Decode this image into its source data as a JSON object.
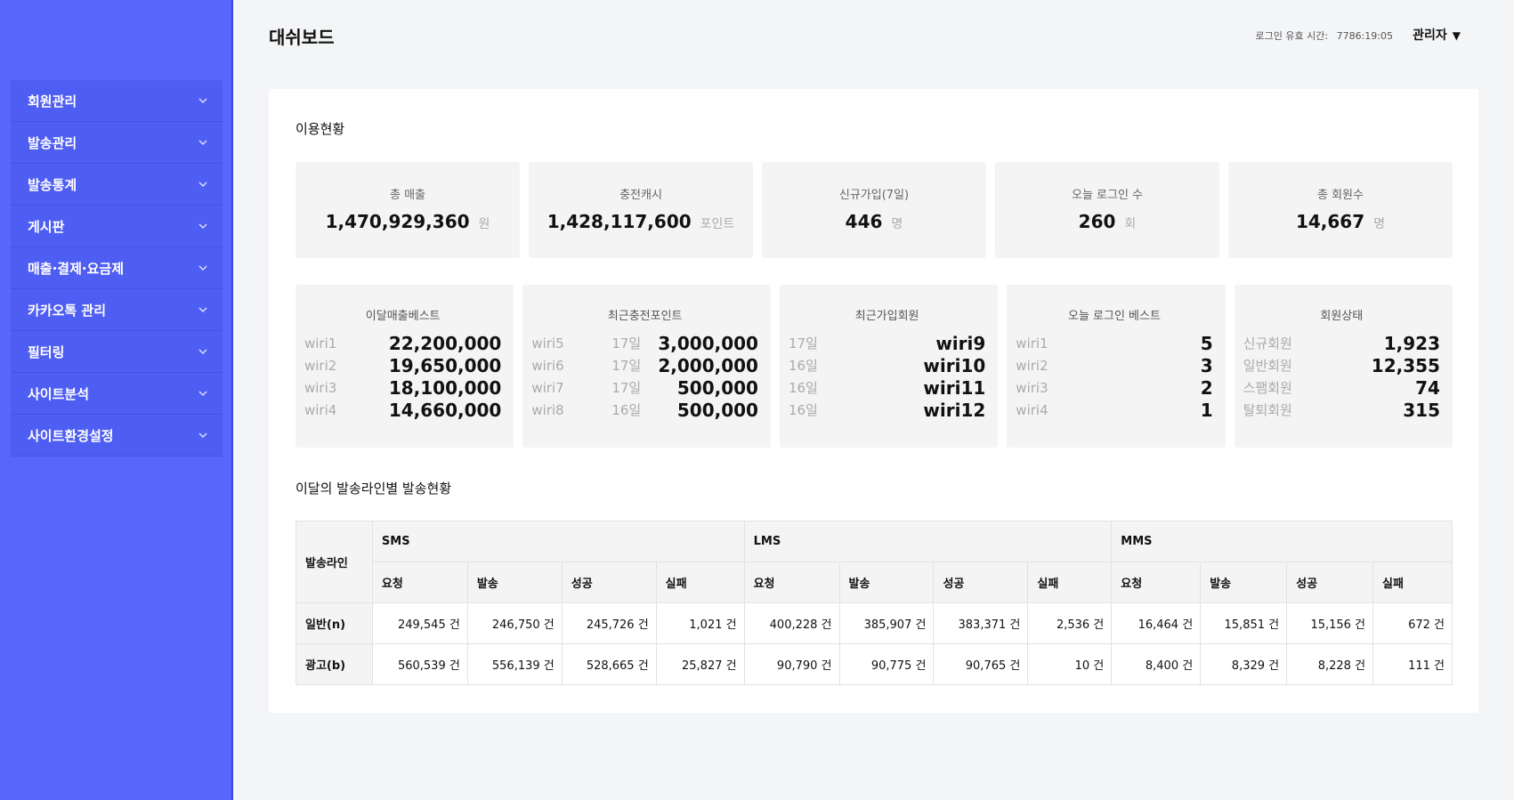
{
  "sidebar": {
    "items": [
      {
        "label": "회원관리",
        "icon": "chevron-down-icon"
      },
      {
        "label": "발송관리",
        "icon": "chevron-down-icon"
      },
      {
        "label": "발송통계",
        "icon": "chevron-down-icon"
      },
      {
        "label": "게시판",
        "icon": "chevron-down-icon"
      },
      {
        "label": "매출·결제·요금제",
        "icon": "chevron-down-icon"
      },
      {
        "label": "카카오톡 관리",
        "icon": "chevron-down-icon"
      },
      {
        "label": "필터링",
        "icon": "chevron-down-icon"
      },
      {
        "label": "사이트분석",
        "icon": "chevron-down-icon"
      },
      {
        "label": "사이트환경설정",
        "icon": "chevron-down-icon"
      }
    ]
  },
  "header": {
    "title": "대쉬보드",
    "login_label": "로그인 유효 시간:",
    "login_time": "7786:19:05",
    "admin_label": "관리자",
    "admin_icon": "caret-down-icon"
  },
  "usage": {
    "title": "이용현황",
    "stats": [
      {
        "label": "총 매출",
        "value": "1,470,929,360",
        "unit": "원"
      },
      {
        "label": "충전캐시",
        "value": "1,428,117,600",
        "unit": "포인트"
      },
      {
        "label": "신규가입(7일)",
        "value": "446",
        "unit": "명"
      },
      {
        "label": "오늘 로그인 수",
        "value": "260",
        "unit": "회"
      },
      {
        "label": "총 회원수",
        "value": "14,667",
        "unit": "명"
      }
    ],
    "best": [
      {
        "title": "이달매출베스트",
        "items": [
          {
            "key": "wiri1",
            "date": "",
            "value": "22,200,000"
          },
          {
            "key": "wiri2",
            "date": "",
            "value": "19,650,000"
          },
          {
            "key": "wiri3",
            "date": "",
            "value": "18,100,000"
          },
          {
            "key": "wiri4",
            "date": "",
            "value": "14,660,000"
          }
        ]
      },
      {
        "title": "최근충전포인트",
        "items": [
          {
            "key": "wiri5",
            "date": "17일",
            "value": "3,000,000"
          },
          {
            "key": "wiri6",
            "date": "17일",
            "value": "2,000,000"
          },
          {
            "key": "wiri7",
            "date": "17일",
            "value": "500,000"
          },
          {
            "key": "wiri8",
            "date": "16일",
            "value": "500,000"
          }
        ]
      },
      {
        "title": "최근가입회원",
        "items": [
          {
            "key": "17일",
            "date": "",
            "value": "wiri9"
          },
          {
            "key": "16일",
            "date": "",
            "value": "wiri10"
          },
          {
            "key": "16일",
            "date": "",
            "value": "wiri11"
          },
          {
            "key": "16일",
            "date": "",
            "value": "wiri12"
          }
        ]
      },
      {
        "title": "오늘 로그인 베스트",
        "items": [
          {
            "key": "wiri1",
            "date": "",
            "value": "5"
          },
          {
            "key": "wiri2",
            "date": "",
            "value": "3"
          },
          {
            "key": "wiri3",
            "date": "",
            "value": "2"
          },
          {
            "key": "wiri4",
            "date": "",
            "value": "1"
          }
        ]
      },
      {
        "title": "회원상태",
        "items": [
          {
            "key": "신규회원",
            "date": "",
            "value": "1,923"
          },
          {
            "key": "일반회원",
            "date": "",
            "value": "12,355"
          },
          {
            "key": "스팸회원",
            "date": "",
            "value": "74"
          },
          {
            "key": "탈퇴회원",
            "date": "",
            "value": "315"
          }
        ]
      }
    ]
  },
  "send_status": {
    "title": "이달의 발송라인별 발송현황",
    "row_header": "발송라인",
    "groups": [
      "SMS",
      "LMS",
      "MMS"
    ],
    "columns": [
      "요청",
      "발송",
      "성공",
      "실패"
    ],
    "rows": [
      {
        "label": "일반(n)",
        "values": [
          "249,545 건",
          "246,750 건",
          "245,726 건",
          "1,021 건",
          "400,228 건",
          "385,907 건",
          "383,371 건",
          "2,536 건",
          "16,464 건",
          "15,851 건",
          "15,156 건",
          "672 건"
        ]
      },
      {
        "label": "광고(b)",
        "values": [
          "560,539 건",
          "556,139 건",
          "528,665 건",
          "25,827 건",
          "90,790 건",
          "90,775 건",
          "90,765 건",
          "10 건",
          "8,400 건",
          "8,329 건",
          "8,228 건",
          "111 건"
        ]
      }
    ]
  },
  "colors": {
    "sidebar": "#5867fb",
    "sidebar_item": "#4f5ef2",
    "card_bg": "#f4f4f5"
  }
}
